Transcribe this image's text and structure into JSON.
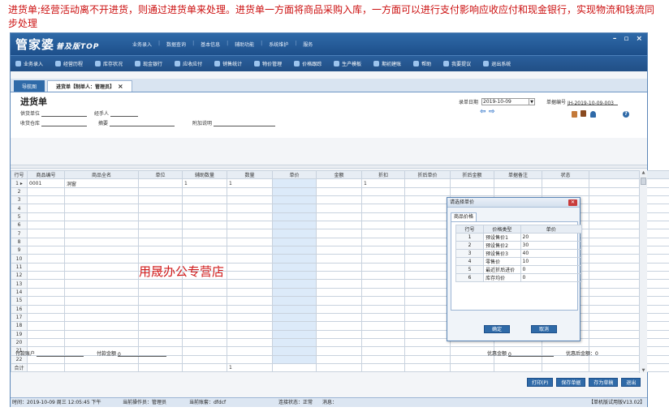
{
  "note": "进货单;经营活动离不开进货，则通过进货单来处理。进货单一方面将商品采购入库，一方面可以进行支付影响应收应付和现金银行，实现物流和钱流同步处理",
  "app": {
    "logo_main": "管家婆",
    "logo_sub": "普及版TOP",
    "top_menu": [
      "业务录入",
      "数据查询",
      "基本信息",
      "辅助功能",
      "系统维护",
      "服务"
    ],
    "win_controls": [
      "–",
      "▫",
      "×"
    ]
  },
  "toolbar": [
    {
      "label": "业务录入",
      "icon": "document-icon"
    },
    {
      "label": "经营历程",
      "icon": "chart-icon"
    },
    {
      "label": "库存状况",
      "icon": "box-icon"
    },
    {
      "label": "现金银行",
      "icon": "yen-icon"
    },
    {
      "label": "应收应付",
      "icon": "exchange-icon"
    },
    {
      "label": "销售统计",
      "icon": "search-icon"
    },
    {
      "label": "物价管理",
      "icon": "gear-icon"
    },
    {
      "label": "价格跟踪",
      "icon": "tag-icon"
    },
    {
      "label": "生产模板",
      "icon": "tools-icon"
    },
    {
      "label": "期初建账",
      "icon": "book-icon"
    },
    {
      "label": "帮助",
      "icon": "question-icon"
    },
    {
      "label": "我要提议",
      "icon": "user-icon"
    },
    {
      "label": "退出系统",
      "icon": "power-icon"
    }
  ],
  "tabs": {
    "nav": "导航图",
    "doc": "进货单【制单人：管理员】"
  },
  "form": {
    "title": "进货单",
    "supplier_label": "供货单位",
    "handler_label": "经手人",
    "warehouse_label": "收货仓库",
    "summary_label": "摘要",
    "extra_label": "附加说明",
    "date_label": "录单日期",
    "date_value": "2019-10-09",
    "docno_label": "单据编号",
    "docno_value": "JH-2019-10-09-003"
  },
  "grid": {
    "columns": [
      "行号",
      "商品编号",
      "商品全名",
      "单位",
      "辅助数量",
      "数量",
      "单价",
      "金额",
      "折扣",
      "折后单价",
      "折后金额",
      "单据备注",
      "状态"
    ],
    "first_row": {
      "code": "0001",
      "name": "洞窗",
      "aux_qty": "1",
      "qty": "1",
      "discount": "1"
    },
    "row_numbers": [
      "1",
      "2",
      "3",
      "4",
      "5",
      "6",
      "7",
      "8",
      "9",
      "10",
      "11",
      "12",
      "13",
      "14",
      "15",
      "16",
      "17",
      "18",
      "19",
      "20",
      "21",
      "22"
    ],
    "total_label": "合计",
    "total_qty": "1"
  },
  "watermark": "用晟办公专营店",
  "footer": {
    "pay_account_label": "付款账户",
    "pay_amount_label": "付款金额",
    "pay_amount_value": "0",
    "discount_amount_label": "优惠金额",
    "discount_amount_value": "0",
    "after_discount_label": "优惠后金额：",
    "after_discount_value": "0"
  },
  "buttons": [
    "打印(P)",
    "保存单据",
    "存为草稿",
    "退出"
  ],
  "status": {
    "time": "时间：2019-10-09 周三 12:05:45 下午",
    "operator": "当前操作员：管理员",
    "account": "当前账套：dfdcf",
    "connection": "连接状态：正常",
    "message": "消息：",
    "version": "【单机版试用版V13.02】"
  },
  "dialog": {
    "title": "请选择单价",
    "tab": "商品价格",
    "columns": [
      "行号",
      "价格类型",
      "单价"
    ],
    "rows": [
      {
        "no": "1",
        "type": "预设售价1",
        "price": "20"
      },
      {
        "no": "2",
        "type": "预设售价2",
        "price": "30"
      },
      {
        "no": "3",
        "type": "预设售价3",
        "price": "40"
      },
      {
        "no": "4",
        "type": "零售价",
        "price": "10"
      },
      {
        "no": "5",
        "type": "最近折后进价",
        "price": "0"
      },
      {
        "no": "6",
        "type": "库存均价",
        "price": "0"
      }
    ],
    "ok": "确定",
    "cancel": "取消"
  },
  "colors": {
    "primary": "#2f6aa8",
    "accent_text": "#cc1010"
  }
}
